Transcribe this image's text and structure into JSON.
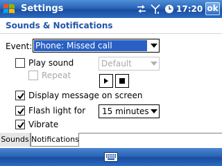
{
  "titlebar": {
    "title": "Settings",
    "time": "17:20",
    "ok_label": "ok"
  },
  "page": {
    "title": "Sounds & Notifications"
  },
  "form": {
    "event_label": "Event:",
    "event_value": "Phone: Missed call",
    "play_sound_label": "Play sound",
    "play_sound_checked": false,
    "sound_value": "Default",
    "repeat_label": "Repeat",
    "repeat_checked": false,
    "display_message_label": "Display message on screen",
    "display_message_checked": true,
    "flash_light_label": "Flash light for",
    "flash_light_checked": true,
    "flash_duration_value": "15 minutes",
    "vibrate_label": "Vibrate",
    "vibrate_checked": true
  },
  "tabs": [
    {
      "label": "Sounds",
      "active": false
    },
    {
      "label": "Notifications",
      "active": true
    }
  ],
  "icons": {
    "start": "windows-flag-icon",
    "connectivity": "data-connection-icon",
    "signal": "signal-strength-icon",
    "clock": "clock-icon",
    "keyboard": "keyboard-icon"
  },
  "colors": {
    "titlebar": "#2a64b8",
    "page_title": "#2256a8",
    "selection": "#2860c4"
  }
}
